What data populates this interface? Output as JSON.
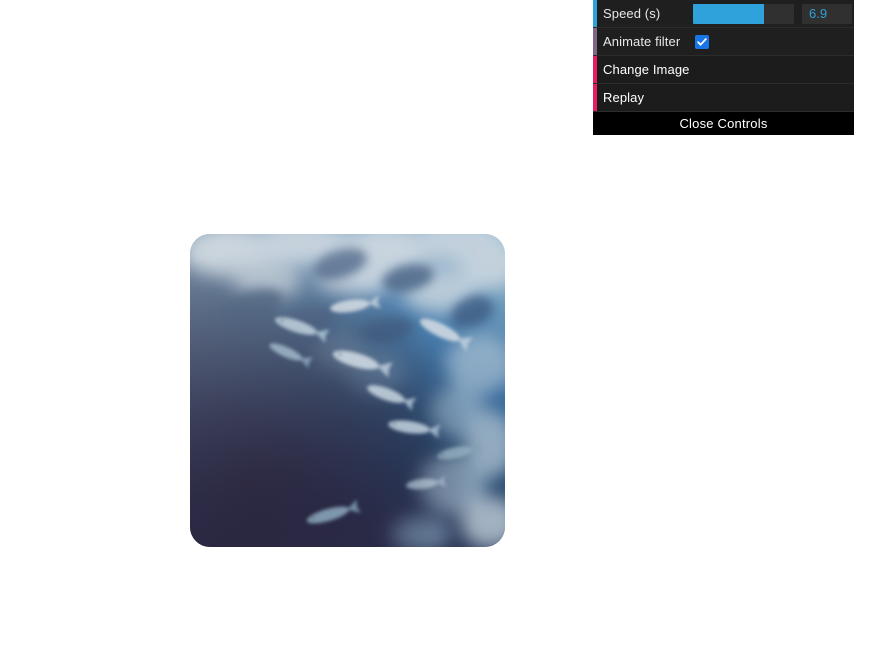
{
  "controls": {
    "panel_name": "dat-gui-controls",
    "rows": [
      {
        "type": "slider",
        "label": "Speed (s)",
        "value": "6.9",
        "fill_percent": 70,
        "accent_color": "#2fa1db"
      },
      {
        "type": "boolean",
        "label": "Animate filter",
        "checked": true,
        "accent_color": "#806787"
      },
      {
        "type": "function",
        "label": "Change Image",
        "accent_color": "#e61d5f"
      },
      {
        "type": "function",
        "label": "Replay",
        "accent_color": "#e61d5f"
      }
    ],
    "close_label": "Close Controls"
  },
  "photo": {
    "name": "underwater-fish-photo",
    "alt": "School of fish swimming in deep blue water seen from above",
    "corner_radius": "20px",
    "palette": {
      "deep": "#2e2740",
      "dark_navy": "#1d3360",
      "mid_blue": "#2f6ea8",
      "light_blue": "#9cc3dd",
      "foam": "#f2f6f8"
    }
  },
  "page": {
    "background": "#ffffff"
  }
}
